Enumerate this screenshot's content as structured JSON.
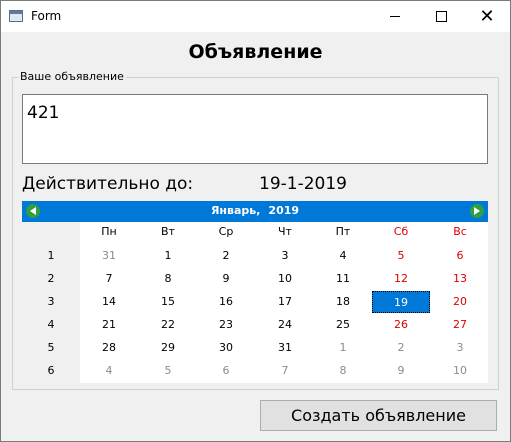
{
  "window": {
    "title": "Form",
    "minimize_icon": "minimize-icon",
    "maximize_icon": "maximize-icon",
    "close_icon": "close-icon"
  },
  "heading": "Объявление",
  "group": {
    "title": "Ваше объявление",
    "input_value": "421"
  },
  "valid": {
    "label": "Действительно до:",
    "date": "19-1-2019"
  },
  "calendar": {
    "month": "Январь,",
    "year": "2019",
    "prev_icon": "arrow-left-icon",
    "next_icon": "arrow-right-icon",
    "weekdays": [
      "Пн",
      "Вт",
      "Ср",
      "Чт",
      "Пт",
      "Сб",
      "Вс"
    ],
    "weeknumbers": [
      "1",
      "2",
      "3",
      "4",
      "5",
      "6"
    ],
    "days": [
      [
        {
          "d": "31",
          "o": true
        },
        {
          "d": "1"
        },
        {
          "d": "2"
        },
        {
          "d": "3"
        },
        {
          "d": "4"
        },
        {
          "d": "5"
        },
        {
          "d": "6"
        }
      ],
      [
        {
          "d": "7"
        },
        {
          "d": "8"
        },
        {
          "d": "9"
        },
        {
          "d": "10"
        },
        {
          "d": "11"
        },
        {
          "d": "12"
        },
        {
          "d": "13"
        }
      ],
      [
        {
          "d": "14"
        },
        {
          "d": "15"
        },
        {
          "d": "16"
        },
        {
          "d": "17"
        },
        {
          "d": "18"
        },
        {
          "d": "19",
          "sel": true
        },
        {
          "d": "20"
        }
      ],
      [
        {
          "d": "21"
        },
        {
          "d": "22"
        },
        {
          "d": "23"
        },
        {
          "d": "24"
        },
        {
          "d": "25"
        },
        {
          "d": "26"
        },
        {
          "d": "27"
        }
      ],
      [
        {
          "d": "28"
        },
        {
          "d": "29"
        },
        {
          "d": "30"
        },
        {
          "d": "31"
        },
        {
          "d": "1",
          "o": true
        },
        {
          "d": "2",
          "o": true
        },
        {
          "d": "3",
          "o": true
        }
      ],
      [
        {
          "d": "4",
          "o": true
        },
        {
          "d": "5",
          "o": true
        },
        {
          "d": "6",
          "o": true
        },
        {
          "d": "7",
          "o": true
        },
        {
          "d": "8",
          "o": true
        },
        {
          "d": "9",
          "o": true
        },
        {
          "d": "10",
          "o": true
        }
      ]
    ],
    "header_color": "#0078d7",
    "weekend_color": "#e00000"
  },
  "create_button": "Создать объявление"
}
